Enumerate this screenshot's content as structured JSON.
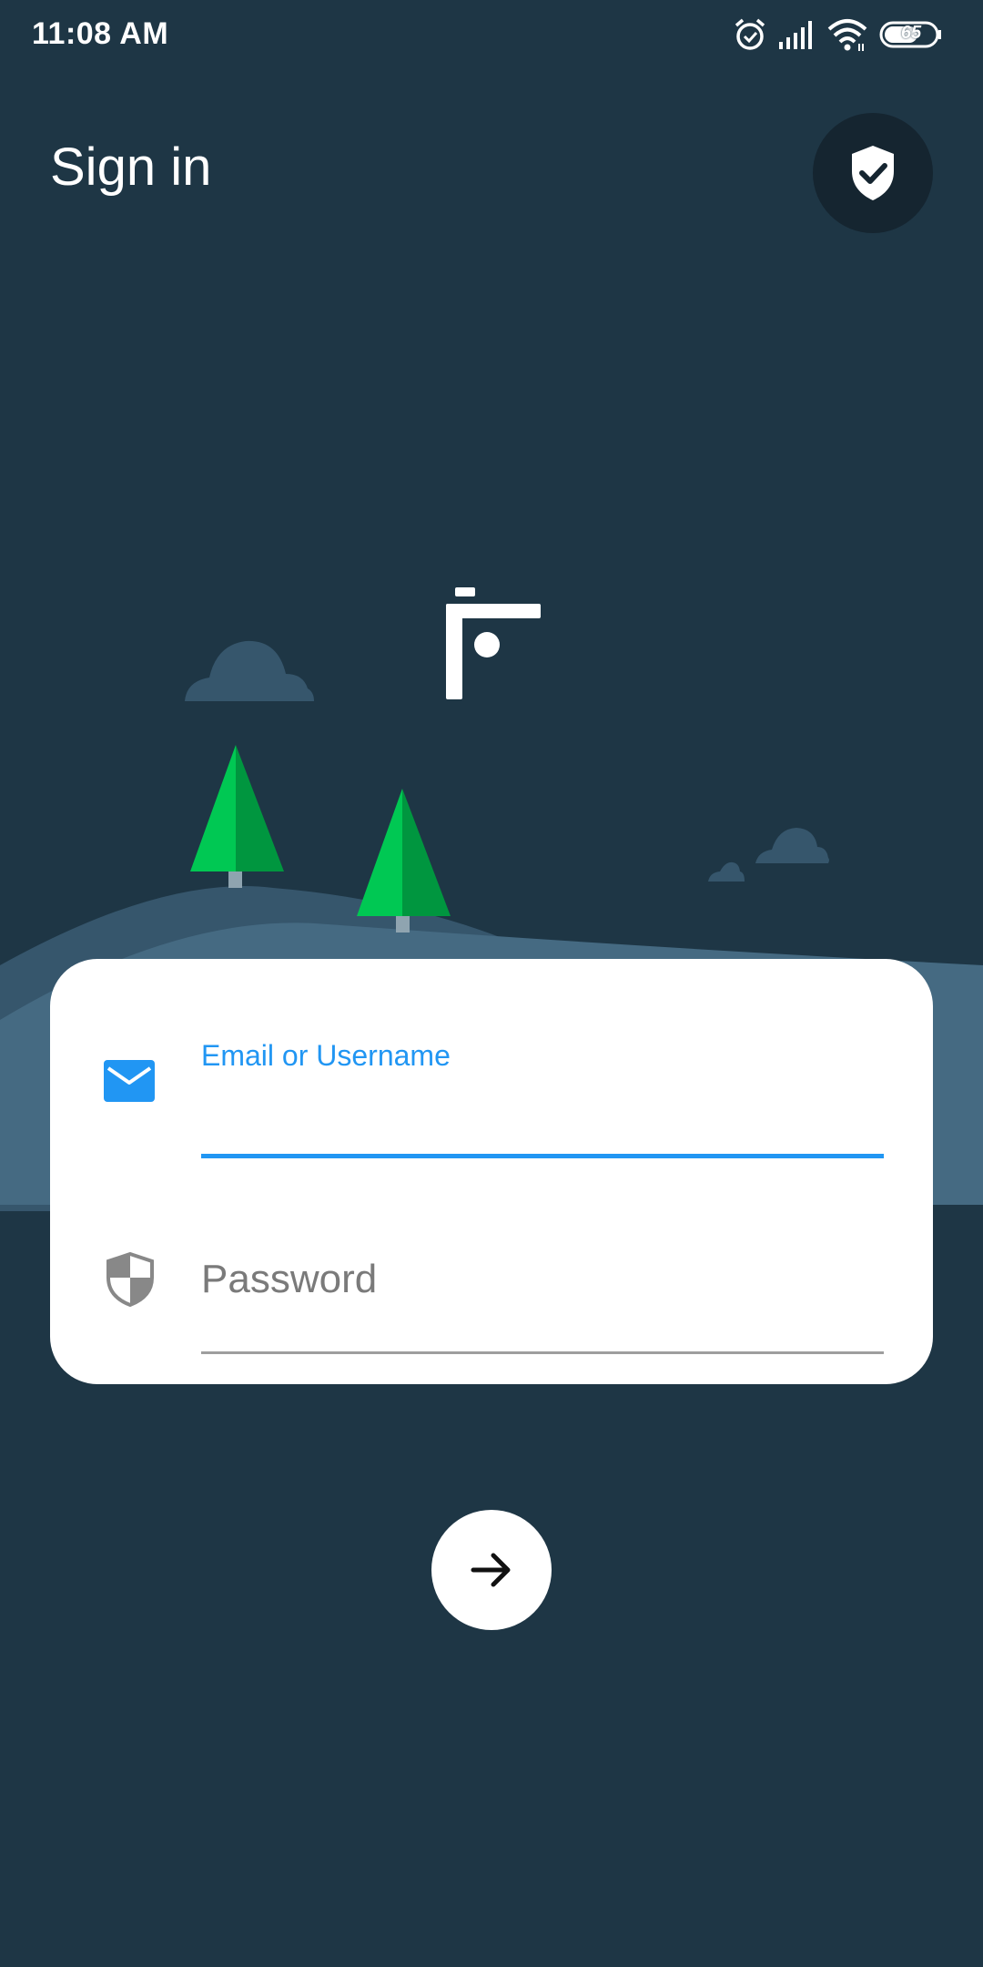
{
  "status_bar": {
    "time": "11:08 AM",
    "battery_level": "65",
    "icons": [
      "alarm-icon",
      "signal-icon",
      "wifi-icon",
      "battery-icon"
    ]
  },
  "header": {
    "title": "Sign in",
    "security_button_icon": "shield-check-icon"
  },
  "login_form": {
    "email": {
      "label": "Email or Username",
      "value": "",
      "icon": "email-icon"
    },
    "password": {
      "placeholder": "Password",
      "value": "",
      "icon": "shield-icon"
    },
    "submit_icon": "arrow-right-icon"
  },
  "colors": {
    "background": "#1e3645",
    "accent": "#2196f3",
    "card": "#ffffff",
    "tree_light": "#00c853",
    "tree_dark": "#00963f",
    "hill": "#456a82"
  }
}
